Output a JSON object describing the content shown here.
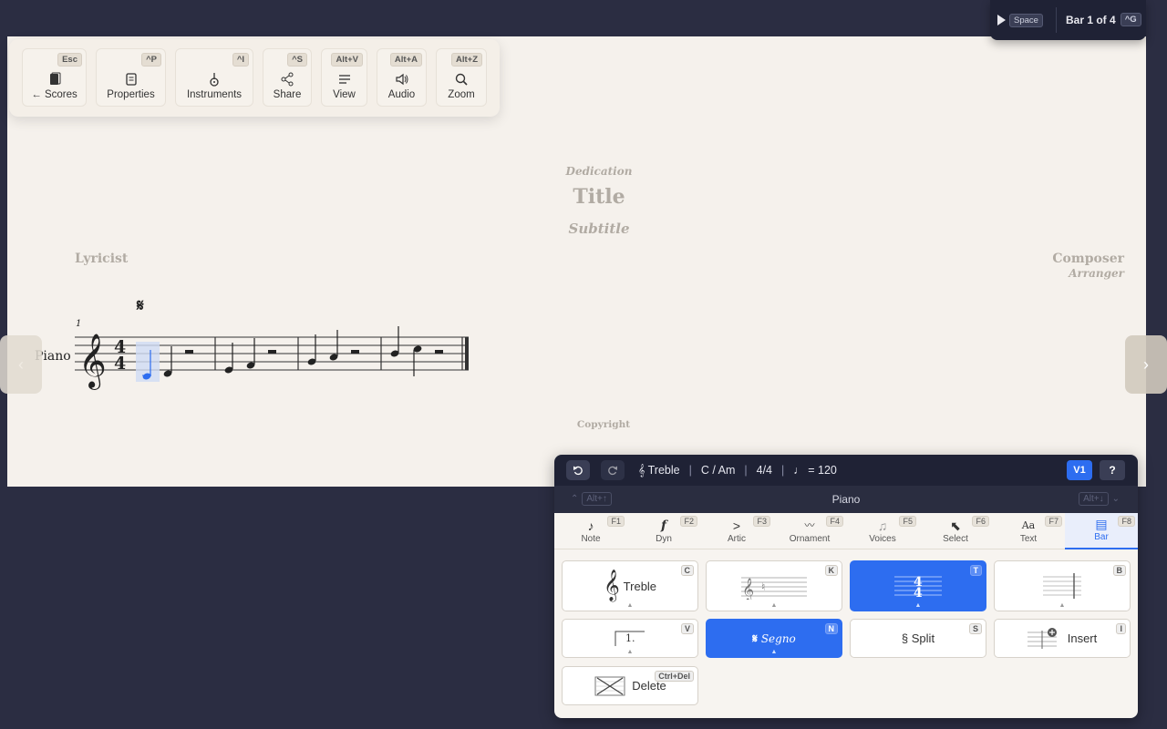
{
  "toolbar": {
    "buttons": [
      {
        "label": "← Scores",
        "key": "Esc",
        "icon": "scores-icon"
      },
      {
        "label": "Properties",
        "key": "^P",
        "icon": "properties-icon"
      },
      {
        "label": "Instruments",
        "key": "^I",
        "icon": "instruments-icon"
      },
      {
        "label": "Share",
        "key": "^S",
        "icon": "share-icon"
      },
      {
        "label": "View",
        "key": "Alt+V",
        "icon": "view-icon"
      },
      {
        "label": "Audio",
        "key": "Alt+A",
        "icon": "audio-icon"
      },
      {
        "label": "Zoom",
        "key": "Alt+Z",
        "icon": "zoom-icon"
      }
    ]
  },
  "playback": {
    "play_key": "Space",
    "bar_label": "Bar 1 of 4",
    "goto_key": "^G"
  },
  "score": {
    "dedication": "Dedication",
    "title": "Title",
    "subtitle": "Subtitle",
    "lyricist": "Lyricist",
    "composer": "Composer",
    "arranger": "Arranger",
    "copyright": "Copyright",
    "instrument": "Piano",
    "bar_number": "1",
    "time_signature": "4/4",
    "clef": "treble",
    "segno": "𝄋",
    "bars": 4,
    "selection_color": "#2d6df0"
  },
  "palette": {
    "status": {
      "clef": "𝄞 Treble",
      "key": "C / Am",
      "time": "4/4",
      "tempo": "♩ = 120",
      "voice": "V1",
      "help": "?"
    },
    "instrument": {
      "prev_key": "Alt+↑",
      "name": "Piano",
      "next_key": "Alt+↓"
    },
    "tabs": [
      {
        "label": "Note",
        "key": "F1",
        "icon": "♪"
      },
      {
        "label": "Dyn",
        "key": "F2",
        "icon": "𝆑"
      },
      {
        "label": "Artic",
        "key": "F3",
        "icon": ">"
      },
      {
        "label": "Ornament",
        "key": "F4",
        "icon": "〰"
      },
      {
        "label": "Voices",
        "key": "F5",
        "icon": "♫"
      },
      {
        "label": "Select",
        "key": "F6",
        "icon": "⬉"
      },
      {
        "label": "Text",
        "key": "F7",
        "icon": "Aa"
      },
      {
        "label": "Bar",
        "key": "F8",
        "icon": "▤"
      }
    ],
    "active_tab": "Bar",
    "buttons": {
      "clef": {
        "label": "Treble",
        "key": "C"
      },
      "keysig": {
        "key": "K"
      },
      "timesig": {
        "key": "T"
      },
      "barline": {
        "key": "B"
      },
      "volta": {
        "label": "1.",
        "key": "V"
      },
      "segno": {
        "label": "Segno",
        "key": "N"
      },
      "split": {
        "label": "§ Split",
        "key": "S"
      },
      "insert": {
        "label": "Insert",
        "key": "I"
      },
      "delete": {
        "label": "Delete",
        "key": "Ctrl+Del"
      }
    }
  }
}
